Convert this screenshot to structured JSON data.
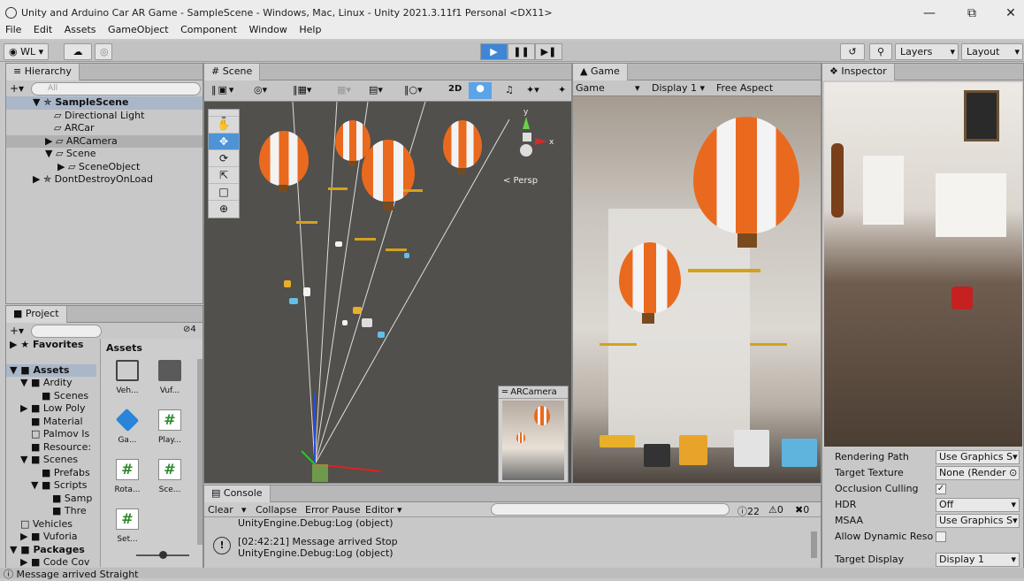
{
  "window": {
    "title": "Unity and Arduino Car AR Game - SampleScene - Windows, Mac, Linux - Unity 2021.3.11f1 Personal <DX11>"
  },
  "menu": [
    "File",
    "Edit",
    "Assets",
    "GameObject",
    "Component",
    "Window",
    "Help"
  ],
  "toolbar": {
    "account": "WL ▾",
    "layers": "Layers",
    "layout": "Layout"
  },
  "hierarchy": {
    "tab": "Hierarchy",
    "search_placeholder": "All",
    "items": [
      "SampleScene",
      "Directional Light",
      "ARCar",
      "ARCamera",
      "Scene",
      "SceneObject",
      "DontDestroyOnLoad"
    ]
  },
  "scene": {
    "tab": "Scene",
    "persp": "< Persp",
    "mode_2d": "2D",
    "arcamera_preview": "ARCamera"
  },
  "game": {
    "tab": "Game",
    "dropdown": "Game",
    "display": "Display 1",
    "aspect": "Free Aspect"
  },
  "inspector": {
    "tab": "Inspector",
    "rows": [
      {
        "label": "Rendering Path",
        "value": "Use Graphics S▾"
      },
      {
        "label": "Target Texture",
        "value": "None (Render ⊙"
      },
      {
        "label": "Occlusion Culling",
        "value": "✓"
      },
      {
        "label": "HDR",
        "value": "Off"
      },
      {
        "label": "MSAA",
        "value": "Use Graphics S▾"
      },
      {
        "label": "Allow Dynamic Reso",
        "value": ""
      },
      {
        "label": "Target Display",
        "value": "Display 1"
      }
    ]
  },
  "project": {
    "tab": "Project",
    "count": "4",
    "tree": [
      "Favorites",
      "Assets",
      "Ardity",
      "Scenes",
      "Low Poly",
      "Material",
      "Palmov Is",
      "Resource:",
      "Scenes",
      "Prefabs",
      "Scripts",
      "Samp",
      "Thre",
      "Vehicles",
      "Vuforia",
      "Packages",
      "Code Cov"
    ],
    "grid_title": "Assets",
    "assets": [
      {
        "name": "Veh...",
        "kind": "folder-empty"
      },
      {
        "name": "Vuf...",
        "kind": "folder"
      },
      {
        "name": "Ga...",
        "kind": "cube"
      },
      {
        "name": "Play...",
        "kind": "script-g"
      },
      {
        "name": "Rota...",
        "kind": "script"
      },
      {
        "name": "Sce...",
        "kind": "script"
      },
      {
        "name": "Set...",
        "kind": "script"
      }
    ]
  },
  "console": {
    "tab": "Console",
    "buttons": [
      "Clear",
      "Collapse",
      "Error Pause",
      "Editor ▾"
    ],
    "counts": {
      "info": "22",
      "warn": "0",
      "error": "0"
    },
    "lines": [
      {
        "text": "UnityEngine.Debug:Log (object)"
      },
      {
        "time": "[02:42:21] Message arrived Stop",
        "text": "UnityEngine.Debug:Log (object)"
      }
    ]
  },
  "status": {
    "text": "Message arrived Straight"
  }
}
